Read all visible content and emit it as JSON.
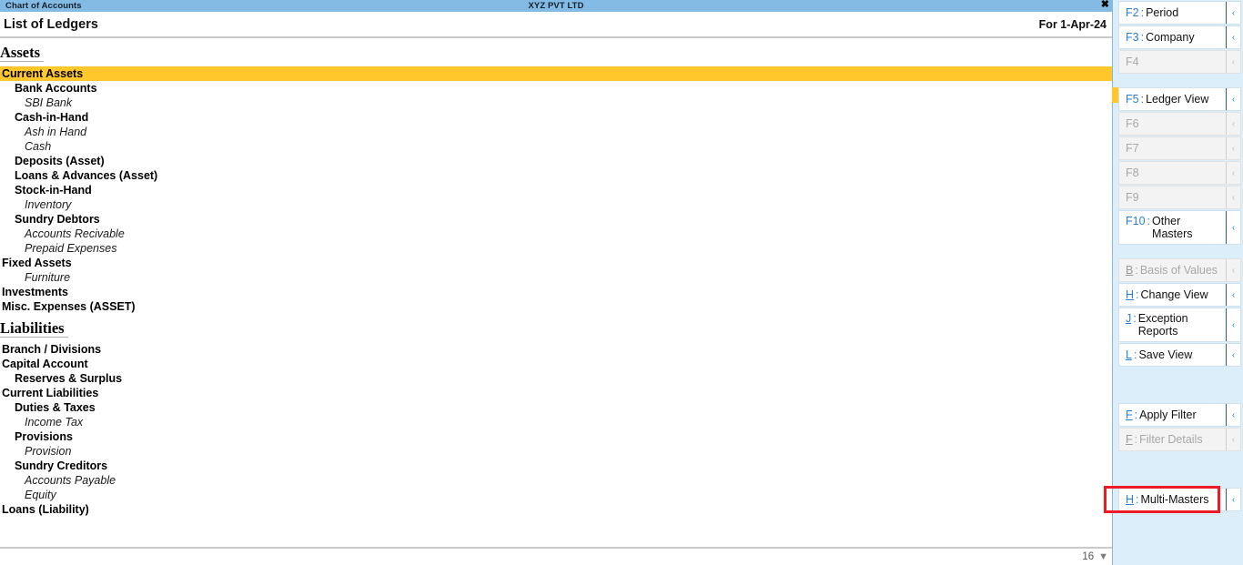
{
  "window": {
    "tab_label": "Chart of Accounts",
    "company_name": "XYZ PVT LTD",
    "close_icon": "✖"
  },
  "report": {
    "title": "List of Ledgers",
    "period_label": "For 1-Apr-24",
    "row_count": "16",
    "footer_caret": "▼"
  },
  "sections": [
    {
      "heading": "Assets",
      "rows": [
        {
          "label": "Current Assets",
          "level": 0,
          "type": "group",
          "selected": true
        },
        {
          "label": "Bank Accounts",
          "level": 1,
          "type": "group",
          "selected": false
        },
        {
          "label": "SBI Bank",
          "level": 2,
          "type": "leaf",
          "selected": false
        },
        {
          "label": "Cash-in-Hand",
          "level": 1,
          "type": "group",
          "selected": false
        },
        {
          "label": "Ash in Hand",
          "level": 2,
          "type": "leaf",
          "selected": false
        },
        {
          "label": "Cash",
          "level": 2,
          "type": "leaf",
          "selected": false
        },
        {
          "label": "Deposits (Asset)",
          "level": 1,
          "type": "group",
          "selected": false
        },
        {
          "label": "Loans & Advances (Asset)",
          "level": 1,
          "type": "group",
          "selected": false
        },
        {
          "label": "Stock-in-Hand",
          "level": 1,
          "type": "group",
          "selected": false
        },
        {
          "label": "Inventory",
          "level": 2,
          "type": "leaf",
          "selected": false
        },
        {
          "label": "Sundry Debtors",
          "level": 1,
          "type": "group",
          "selected": false
        },
        {
          "label": "Accounts Recivable",
          "level": 2,
          "type": "leaf",
          "selected": false
        },
        {
          "label": "Prepaid Expenses",
          "level": 2,
          "type": "leaf",
          "selected": false
        },
        {
          "label": "Fixed Assets",
          "level": 0,
          "type": "group",
          "selected": false
        },
        {
          "label": "Furniture",
          "level": 2,
          "type": "leaf",
          "selected": false
        },
        {
          "label": "Investments",
          "level": 0,
          "type": "group",
          "selected": false
        },
        {
          "label": "Misc. Expenses (ASSET)",
          "level": 0,
          "type": "group",
          "selected": false
        }
      ]
    },
    {
      "heading": "Liabilities",
      "rows": [
        {
          "label": "Branch / Divisions",
          "level": 0,
          "type": "group",
          "selected": false
        },
        {
          "label": "Capital Account",
          "level": 0,
          "type": "group",
          "selected": false
        },
        {
          "label": "Reserves & Surplus",
          "level": 1,
          "type": "group",
          "selected": false
        },
        {
          "label": "Current Liabilities",
          "level": 0,
          "type": "group",
          "selected": false
        },
        {
          "label": "Duties & Taxes",
          "level": 1,
          "type": "group",
          "selected": false
        },
        {
          "label": "Income Tax",
          "level": 2,
          "type": "leaf",
          "selected": false
        },
        {
          "label": "Provisions",
          "level": 1,
          "type": "group",
          "selected": false
        },
        {
          "label": "Provision",
          "level": 2,
          "type": "leaf",
          "selected": false
        },
        {
          "label": "Sundry Creditors",
          "level": 1,
          "type": "group",
          "selected": false
        },
        {
          "label": "Accounts Payable",
          "level": 2,
          "type": "leaf",
          "selected": false
        },
        {
          "label": "Equity",
          "level": 2,
          "type": "leaf",
          "selected": false
        },
        {
          "label": "Loans (Liability)",
          "level": 0,
          "type": "group",
          "selected": false
        }
      ]
    }
  ],
  "sidebar": {
    "chevron_icon": "‹",
    "scroll_caret_icon": "▼",
    "groups": [
      {
        "items": [
          {
            "key": "F2",
            "label": "Period",
            "disabled": false,
            "key_style": "fkey"
          },
          {
            "key": "F3",
            "label": "Company",
            "disabled": false,
            "key_style": "fkey"
          },
          {
            "key": "F4",
            "label": "",
            "disabled": true,
            "key_style": "fkey"
          }
        ]
      },
      {
        "items": [
          {
            "key": "F5",
            "label": "Ledger View",
            "disabled": false,
            "key_style": "fkey"
          },
          {
            "key": "F6",
            "label": "",
            "disabled": true,
            "key_style": "fkey"
          },
          {
            "key": "F7",
            "label": "",
            "disabled": true,
            "key_style": "fkey"
          },
          {
            "key": "F8",
            "label": "",
            "disabled": true,
            "key_style": "fkey"
          },
          {
            "key": "F9",
            "label": "",
            "disabled": true,
            "key_style": "fkey"
          },
          {
            "key": "F10",
            "label": "Other Masters",
            "disabled": false,
            "key_style": "fkey"
          }
        ]
      },
      {
        "items": [
          {
            "key": "B",
            "label": "Basis of Values",
            "disabled": true,
            "key_style": "letter"
          },
          {
            "key": "H",
            "label": "Change View",
            "disabled": false,
            "key_style": "letter"
          },
          {
            "key": "J",
            "label": "Exception Reports",
            "disabled": false,
            "key_style": "letter"
          },
          {
            "key": "L",
            "label": "Save View",
            "disabled": false,
            "key_style": "letter"
          }
        ]
      },
      {
        "items": [
          {
            "key": "F",
            "label": "Apply Filter",
            "disabled": false,
            "key_style": "letter"
          },
          {
            "key": "F",
            "label": "Filter Details",
            "disabled": true,
            "key_style": "letter"
          }
        ]
      },
      {
        "items": [
          {
            "key": "H",
            "label": "Multi-Masters",
            "disabled": false,
            "key_style": "letter",
            "annotated": true
          }
        ]
      }
    ]
  },
  "colors": {
    "titlebar": "#83bbe5",
    "selected_row": "#ffc72c",
    "sidebar_bg": "#ddeefb",
    "accent_key": "#2a7fd4",
    "annotation": "#ee1b24"
  }
}
